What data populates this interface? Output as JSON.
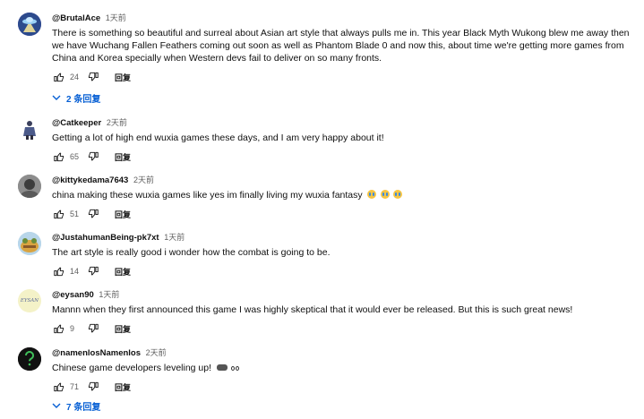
{
  "comments": [
    {
      "author": "@BrutalAce",
      "time": "1天前",
      "text": "There is something so beautiful and surreal about Asian art style that always pulls me in. This year Black Myth Wukong blew me away then we have Wuchang Fallen Feathers coming out soon as well as Phantom Blade 0 and now this, about time we're getting more games from China and Korea specially when Western devs fail to deliver on so many fronts.",
      "likes": "24",
      "reply_label": "回复",
      "replies_label": "2 条回复",
      "avatar": "ufo-avatar"
    },
    {
      "author": "@Catkeeper",
      "time": "2天前",
      "text": "Getting a lot of high end wuxia games these days, and I am very happy about it!",
      "likes": "65",
      "reply_label": "回复",
      "avatar": "warrior-avatar"
    },
    {
      "author": "@kittykedama7643",
      "time": "2天前",
      "text": "china making these wuxia games like yes im finally living my wuxia fantasy",
      "emojis": [
        "crying-face",
        "crying-face",
        "crying-face"
      ],
      "likes": "51",
      "reply_label": "回复",
      "avatar": "photo-avatar"
    },
    {
      "author": "@JustahumanBeing-pk7xt",
      "time": "1天前",
      "text": "The art style is really good i wonder how the combat is going to be.",
      "likes": "14",
      "reply_label": "回复",
      "avatar": "frog-avatar"
    },
    {
      "author": "@eysan90",
      "time": "1天前",
      "text": "Mannn when they first announced this game I was highly skeptical that it would ever be released. But this is such great news!",
      "likes": "9",
      "reply_label": "回复",
      "avatar": "text-avatar",
      "avatar_text": "EYSAN"
    },
    {
      "author": "@namenlosNamenlos",
      "time": "2天前",
      "text": "Chinese game developers leveling up!",
      "emojis": [
        "video-game",
        "eyes"
      ],
      "likes": "71",
      "reply_label": "回复",
      "replies_label": "7 条回复",
      "avatar": "question-mark-avatar"
    }
  ],
  "colors": {
    "link": "#065fd4",
    "secondary_text": "#606060",
    "primary_text": "#0f0f0f"
  }
}
